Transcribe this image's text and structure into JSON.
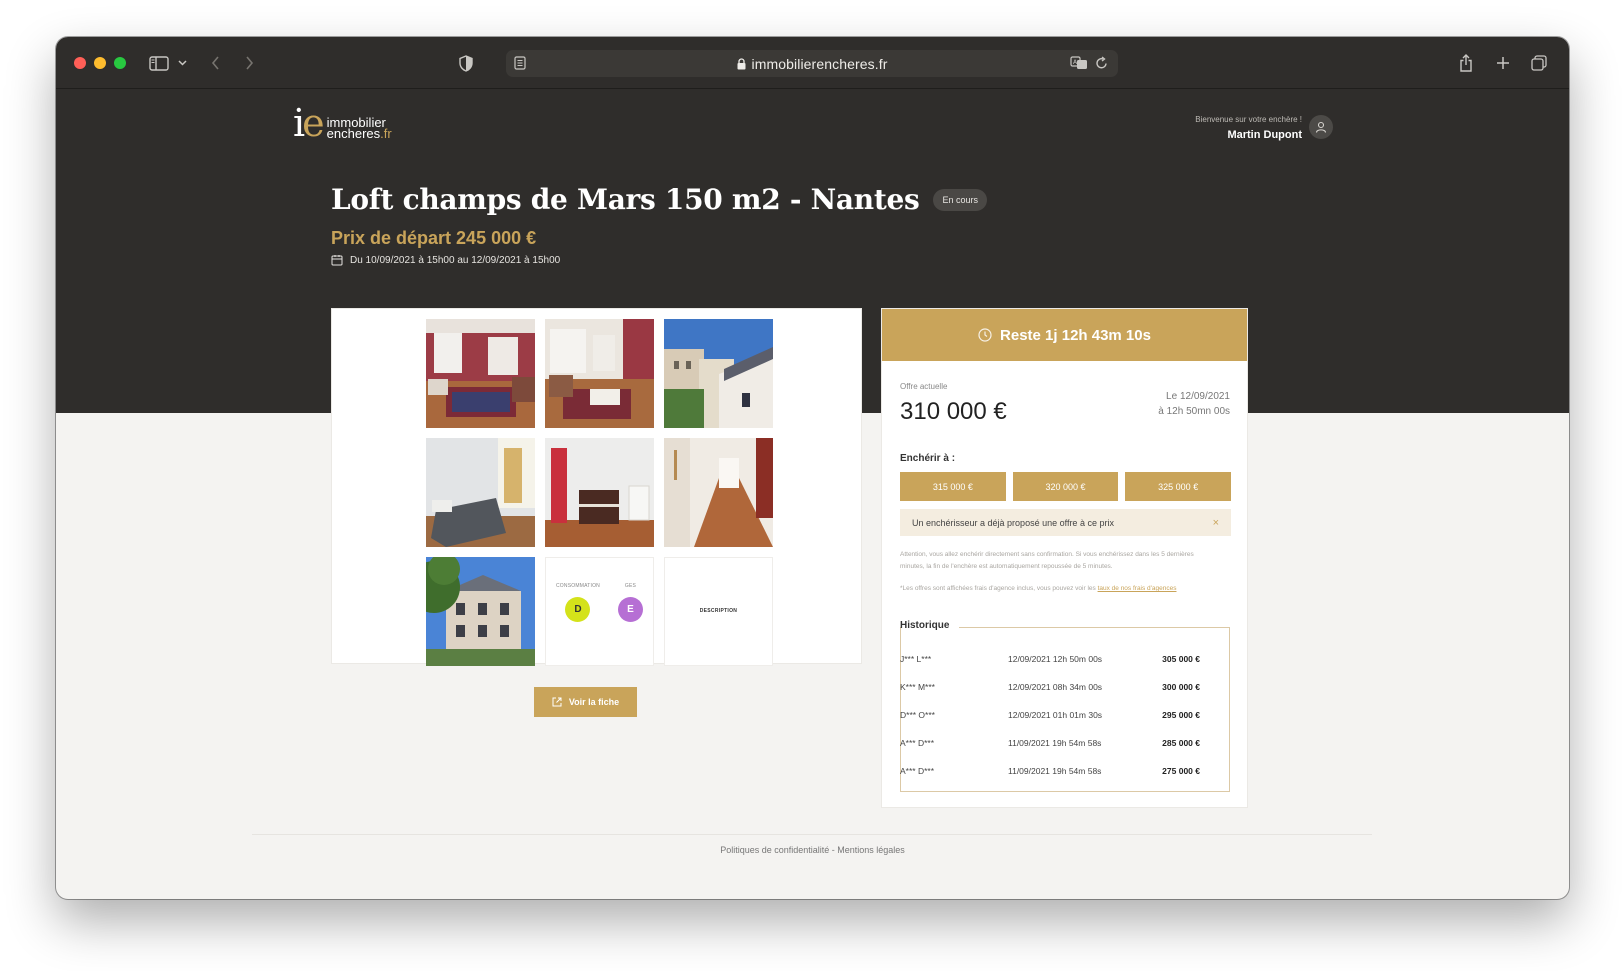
{
  "browser": {
    "url": "immobilierencheres.fr",
    "traffic_lights": {
      "close": "#ff5f57",
      "minimize": "#febc2e",
      "zoom": "#28c840"
    }
  },
  "brand": {
    "mark_i": "i",
    "mark_e": "e",
    "line1": "immobilier",
    "line2": "encheres",
    "line2_suffix": ".fr",
    "accent": "#c9a45a"
  },
  "user": {
    "welcome": "Bienvenue sur votre enchère !",
    "name": "Martin Dupont"
  },
  "listing": {
    "title": "Loft champs de Mars 150 m2 - Nantes",
    "status": "En cours",
    "starting_price": "Prix de départ 245 000 €",
    "dates": "Du 10/09/2021 à 15h00 au 12/09/2021 à 15h00"
  },
  "gallery": {
    "energy": {
      "conso_label": "CONSOMMATION",
      "conso_value": "D",
      "conso_color": "#d4e21a",
      "ges_label": "GES",
      "ges_value": "E",
      "ges_color": "#b66fd4"
    },
    "description_label": "DESCRIPTION",
    "view_button": "Voir la fiche"
  },
  "auction": {
    "countdown": "Reste 1j 12h 43m 10s",
    "current_offer_label": "Offre actuelle",
    "current_offer": "310 000 €",
    "offer_date_line1": "Le 12/09/2021",
    "offer_date_line2": "à 12h 50mn 00s",
    "bid_label": "Enchérir à :",
    "bids": [
      "315 000 €",
      "320 000 €",
      "325 000 €"
    ],
    "alert": "Un enchérisseur a déjà proposé une offre à ce prix",
    "alert_close": "×",
    "warning": "Attention, vous allez enchérir directement sans confirmation. Si vous enchérissez dans les 5 dernières minutes, la fin de l'enchère est automatiquement repoussée de 5 minutes.",
    "fees_note": "*Les offres sont affichées frais d'agence inclus, vous pouvez voir les ",
    "fees_link": "taux de nos frais d'agences",
    "history_label": "Historique",
    "history": [
      {
        "name": "J*** L***",
        "date": "12/09/2021 12h 50m 00s",
        "amount": "305 000 €"
      },
      {
        "name": "K*** M***",
        "date": "12/09/2021 08h 34m 00s",
        "amount": "300 000 €"
      },
      {
        "name": "D*** O***",
        "date": "12/09/2021 01h 01m 30s",
        "amount": "295 000 €"
      },
      {
        "name": "A*** D***",
        "date": "11/09/2021 19h 54m 58s",
        "amount": "285 000 €"
      },
      {
        "name": "A*** D***",
        "date": "11/09/2021 19h 54m 58s",
        "amount": "275 000 €"
      }
    ]
  },
  "footer": {
    "links": "Politiques de confidentialité - Mentions légales"
  }
}
